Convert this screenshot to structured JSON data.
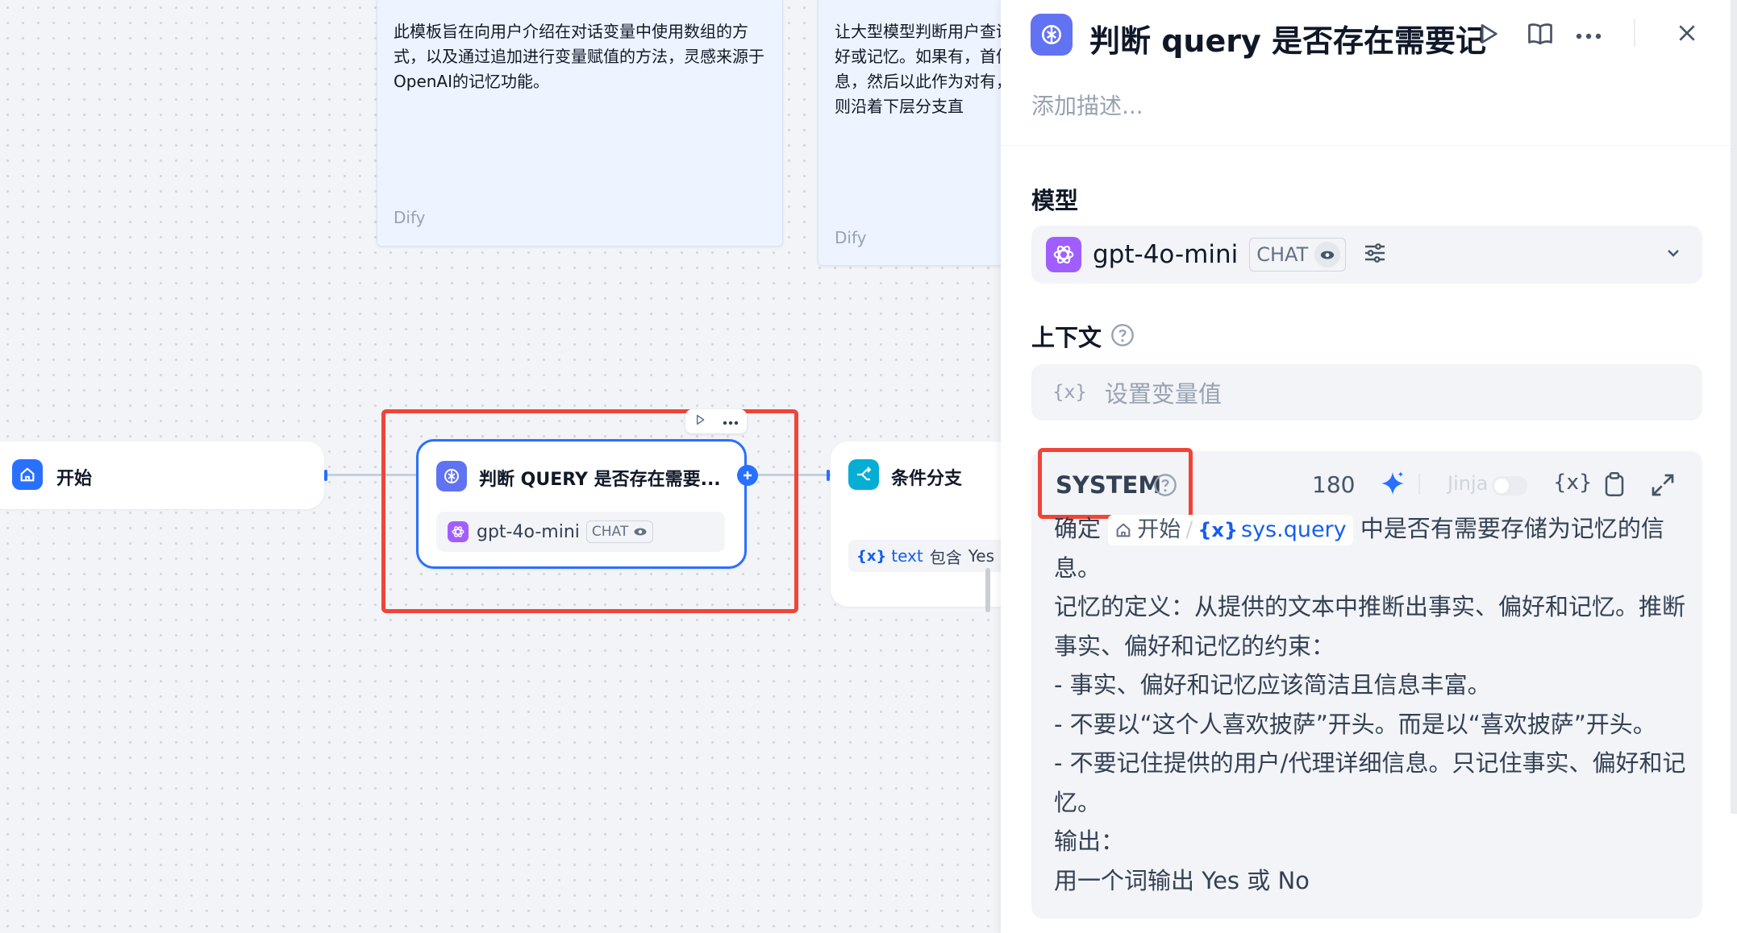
{
  "canvas": {
    "notes": [
      {
        "text": "此模板旨在向用户介绍在对话变量中使用数组的方式，以及通过追加进行变量赋值的方法，灵感来源于OpenAI的记忆功能。",
        "source": "Dify"
      },
      {
        "text": "让大型模型判断用户查询好或记忆。如果有，首信息，然后以此作为对有，则沿着下层分支直",
        "source": "Dify"
      }
    ],
    "nodes": {
      "start": {
        "title": "开始"
      },
      "llm": {
        "title": "判断 QUERY 是否存在需要...",
        "model": "gpt-4o-mini",
        "mode": "CHAT",
        "toolbar_icons": [
          "play-icon",
          "more-icon"
        ]
      },
      "branch": {
        "title": "条件分支",
        "condition_var": "text",
        "condition_op": "包含",
        "condition_value": "Yes"
      }
    }
  },
  "panel": {
    "title": "判断 query 是否存在需要记",
    "description_placeholder": "添加描述...",
    "model_label": "模型",
    "model": {
      "name": "gpt-4o-mini",
      "mode": "CHAT"
    },
    "context_label": "上下文",
    "context_placeholder": "设置变量值",
    "system_label": "SYSTEM",
    "token_count": "180",
    "jinja_label": "Jinja",
    "prompt": {
      "prefix": "确定",
      "var_node": "开始",
      "var_sep": "/",
      "var_name": "sys.query",
      "suffix": "中是否有需要存储为记忆的信息。",
      "lines": [
        "记忆的定义：从提供的文本中推断出事实、偏好和记忆。推断事实、偏好和记忆的约束：",
        "- 事实、偏好和记忆应该简洁且信息丰富。",
        "- 不要以“这个人喜欢披萨”开头。而是以“喜欢披萨”开头。",
        "- 不要记住提供的用户/代理详细信息。只记住事实、偏好和记忆。",
        "输出：",
        "用一个词输出 Yes 或 No"
      ]
    }
  },
  "colors": {
    "accent": "#2970ff",
    "llm_icon": "#6172f3",
    "branch_icon": "#06aed4",
    "highlight": "#f04438",
    "openai": "#a15eff"
  }
}
